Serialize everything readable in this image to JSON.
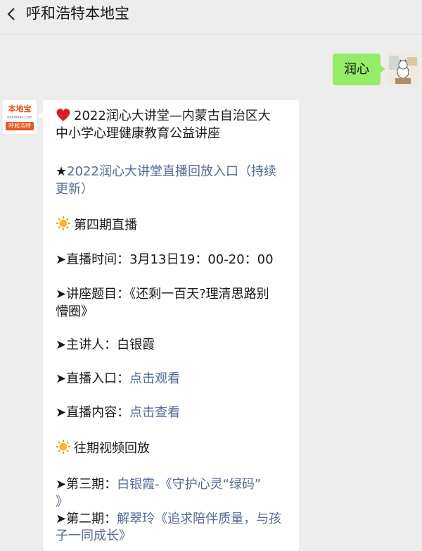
{
  "header": {
    "title": "呼和浩特本地宝"
  },
  "messages": {
    "outgoing_text": "润心",
    "bot_logo": {
      "brand": "本地宝",
      "url": "bendibao.com",
      "tag": "呼和浩特"
    },
    "card": {
      "heading_line1": "2022润心大讲堂—内蒙古自治区大",
      "heading_line2": "中小学心理健康教育公益讲座",
      "star": "★",
      "replay_link_line1": "2022润心大讲堂直播回放入口（持续",
      "replay_link_line2": "更新）",
      "period4_title": "第四期直播",
      "arrow": "➤",
      "time_label": "直播时间：",
      "time_value": "3月13日19：00-20：00",
      "topic_label": "讲座题目：",
      "topic_value_line1": "《还剩一百天?理清思路别",
      "topic_value_line2": "懵圈》",
      "speaker_label": "主讲人：",
      "speaker_value": "白银霞",
      "entry_label": "直播入口：",
      "entry_link": "点击观看",
      "content_label": "直播内容：",
      "content_link": "点击查看",
      "past_title": "往期视频回放",
      "p3_label": "第三期：",
      "p3_link_line1": "白银霞-《守护心灵“绿码”",
      "p3_link_line2": "》",
      "p2_label": "第二期：",
      "p2_link_line1": "解翠玲《追求陪伴质量，与孩",
      "p2_link_line2": "子一同成长》"
    }
  },
  "colors": {
    "background": "#ededed",
    "outgoing_bubble": "#95ec69",
    "link": "#576b95",
    "brand_orange": "#e8561e"
  }
}
